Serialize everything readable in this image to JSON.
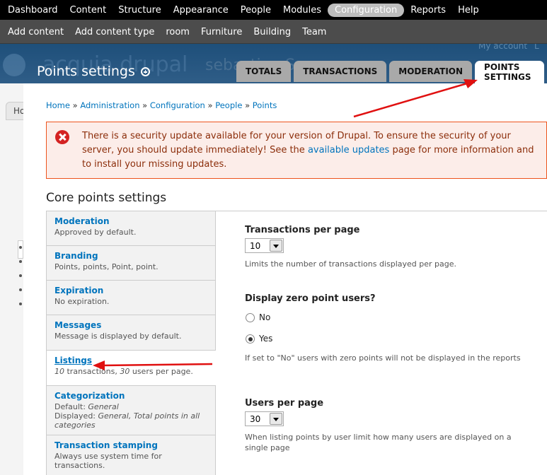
{
  "toolbar": {
    "items": [
      "Dashboard",
      "Content",
      "Structure",
      "Appearance",
      "People",
      "Modules",
      "Configuration",
      "Reports",
      "Help"
    ],
    "active": "Configuration"
  },
  "shortcuts": [
    "Add content",
    "Add content type",
    "room",
    "Furniture",
    "Building",
    "Team"
  ],
  "header": {
    "logo_text": "acquia drupal",
    "site_name": "sebastian Sno",
    "my_account": "My account",
    "logout": "L",
    "page_title": "Points settings"
  },
  "tabs": [
    "TOTALS",
    "TRANSACTIONS",
    "MODERATION",
    "POINTS SETTINGS"
  ],
  "bg_page": {
    "tab_fragment": "Ho"
  },
  "breadcrumb": {
    "items": [
      "Home",
      "Administration",
      "Configuration",
      "People",
      "Points"
    ],
    "separator": "»"
  },
  "message": {
    "text_before": "There is a security update available for your version of Drupal. To ensure the security of your server, you should update immediately! See the ",
    "link": "available updates",
    "text_after": " page for more information and to install your missing updates."
  },
  "section_title": "Core points settings",
  "vertical_tabs": [
    {
      "title": "Moderation",
      "summary": "Approved by default."
    },
    {
      "title": "Branding",
      "summary": "Points, points, Point, point."
    },
    {
      "title": "Expiration",
      "summary": "No expiration."
    },
    {
      "title": "Messages",
      "summary": "Message is displayed by default."
    },
    {
      "title": "Listings",
      "summary_parts": [
        "10",
        " transactions, ",
        "30",
        " users per page."
      ]
    },
    {
      "title": "Categorization",
      "summary_lines": [
        [
          "Default: ",
          "General"
        ],
        [
          "Displayed: ",
          "General, Total points in all categories"
        ]
      ]
    },
    {
      "title": "Transaction stamping",
      "summary": "Always use system time for transactions."
    }
  ],
  "form": {
    "transactions_per_page": {
      "label": "Transactions per page",
      "value": "10",
      "description": "Limits the number of transactions displayed per page."
    },
    "display_zero": {
      "label": "Display zero point users?",
      "options": [
        "No",
        "Yes"
      ],
      "selected": "Yes",
      "description": "If set to \"No\" users with zero points will not be displayed in the reports"
    },
    "users_per_page": {
      "label": "Users per page",
      "value": "30",
      "description": "When listing points by user limit how many users are displayed on a single page"
    }
  },
  "colors": {
    "link": "#0074bd",
    "error_border": "#ed541d",
    "annotation_arrow": "#e01010"
  }
}
